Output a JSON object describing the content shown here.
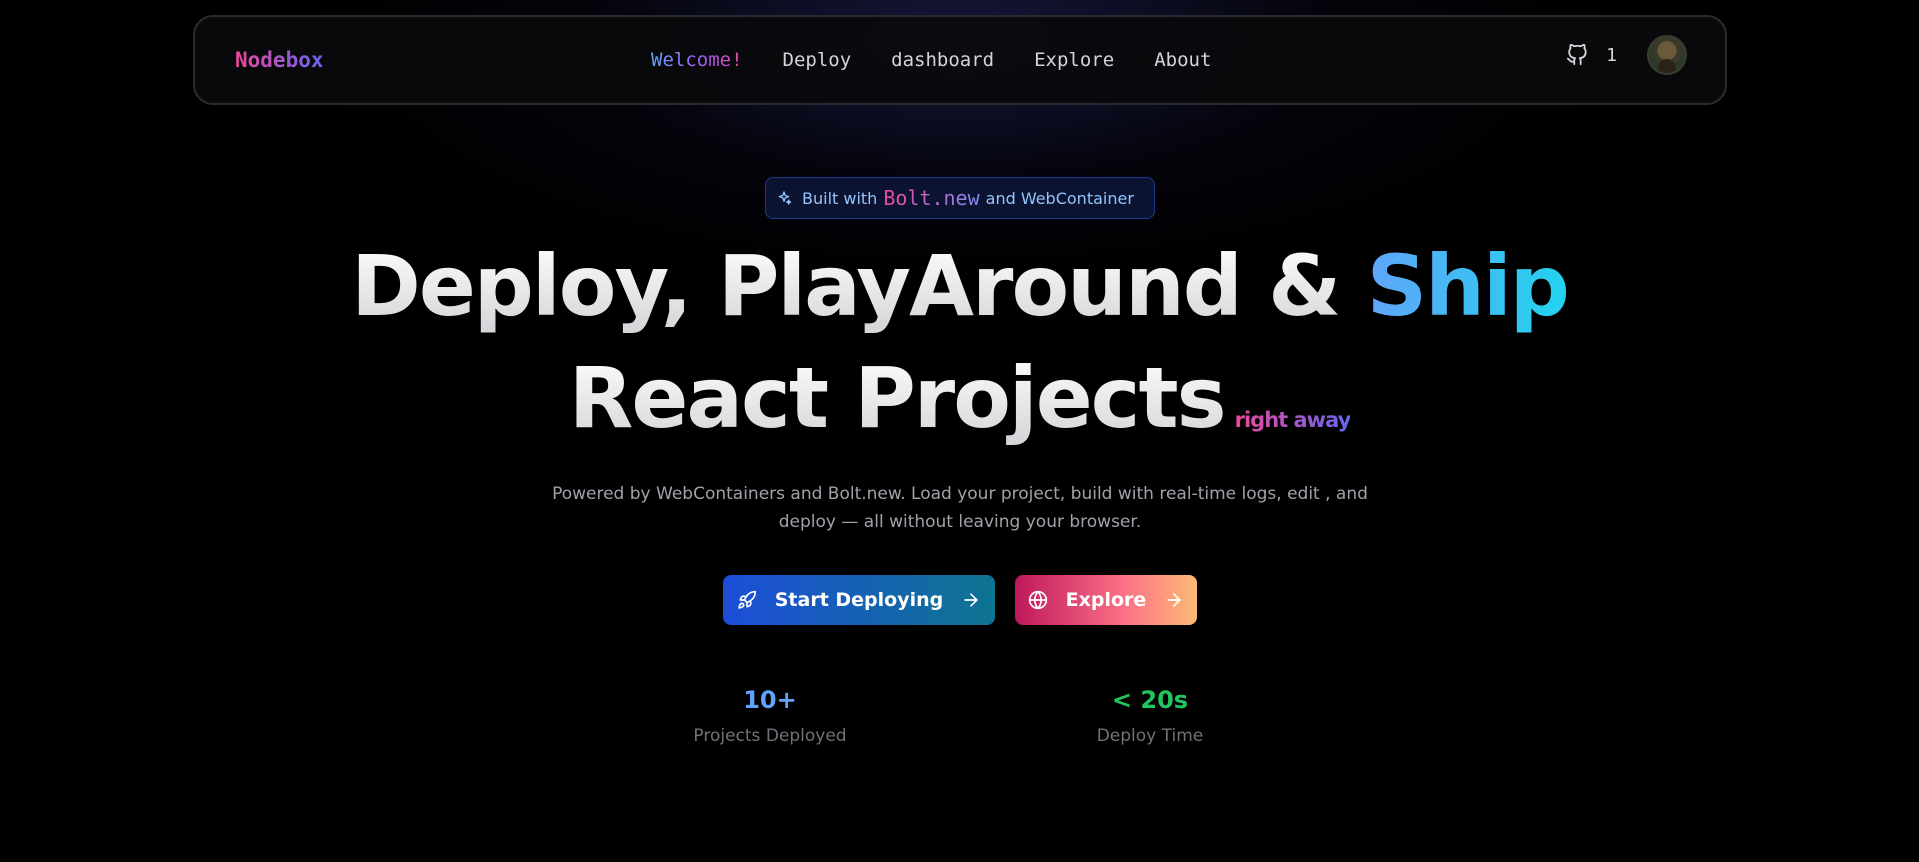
{
  "navbar": {
    "logo": "Nodebox",
    "links": [
      "Welcome!",
      "Deploy",
      "dashboard",
      "Explore",
      "About"
    ],
    "github_count": "1"
  },
  "badge": {
    "prefix": "Built with",
    "bolt": "Bolt.new",
    "suffix": "and WebContainer"
  },
  "headline": {
    "line1_white": "Deploy, PlayAround & ",
    "line1_accent": "Ship",
    "line2_white": "React Projects",
    "line2_small": "right away"
  },
  "description": "Powered by WebContainers and Bolt.new. Load your project, build with real-time logs, edit , and deploy — all without leaving your browser.",
  "buttons": {
    "deploy": "Start Deploying",
    "explore": "Explore"
  },
  "stats": [
    {
      "value": "10+",
      "label": "Projects Deployed"
    },
    {
      "value": "< 20s",
      "label": "Deploy Time"
    }
  ],
  "colors": {
    "accent_blue": "#60a5fa",
    "accent_pink": "#ec4899",
    "accent_green": "#22c55e"
  }
}
